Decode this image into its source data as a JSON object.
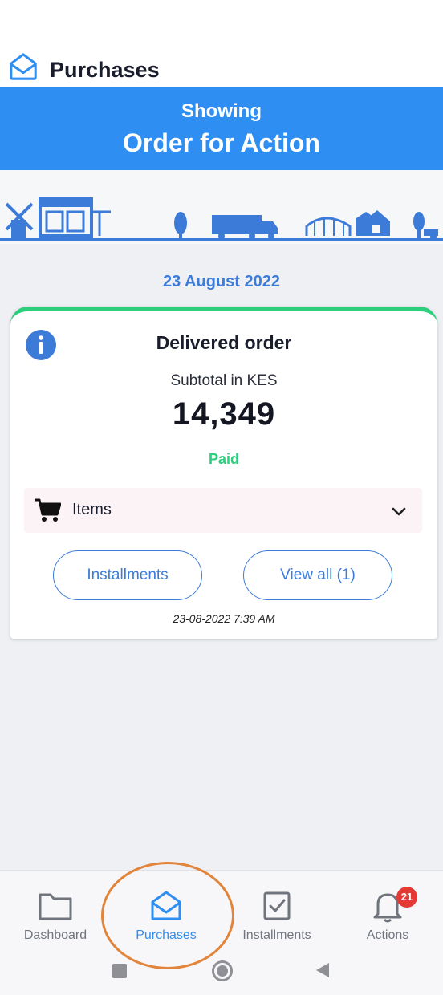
{
  "header": {
    "title": "Purchases",
    "logo_icon": "envelope-open-icon"
  },
  "banner": {
    "line1": "Showing",
    "line2": "Order for Action",
    "color": "#2f8ef2"
  },
  "date_label": "23 August 2022",
  "order_card": {
    "info_icon": "info-icon",
    "title": "Delivered order",
    "subtotal_label": "Subtotal in KES",
    "amount": "14,349",
    "status": "Paid",
    "status_color": "#2dce7d",
    "items": {
      "label": "Items",
      "icon": "cart-icon",
      "toggle_icon": "chevron-down-icon"
    },
    "buttons": {
      "installments": "Installments",
      "view_all": "View all (1)"
    },
    "timestamp": "23-08-2022 7:39 AM"
  },
  "bottom_nav": {
    "items": [
      {
        "label": "Dashboard",
        "icon": "folder-icon",
        "active": false
      },
      {
        "label": "Purchases",
        "icon": "envelope-open-icon",
        "active": true
      },
      {
        "label": "Installments",
        "icon": "checkbox-icon",
        "active": false
      },
      {
        "label": "Actions",
        "icon": "bell-icon",
        "active": false,
        "badge": "21"
      }
    ]
  },
  "system_nav": {
    "icons": [
      "recents-square-icon",
      "home-circle-icon",
      "back-triangle-icon"
    ]
  }
}
